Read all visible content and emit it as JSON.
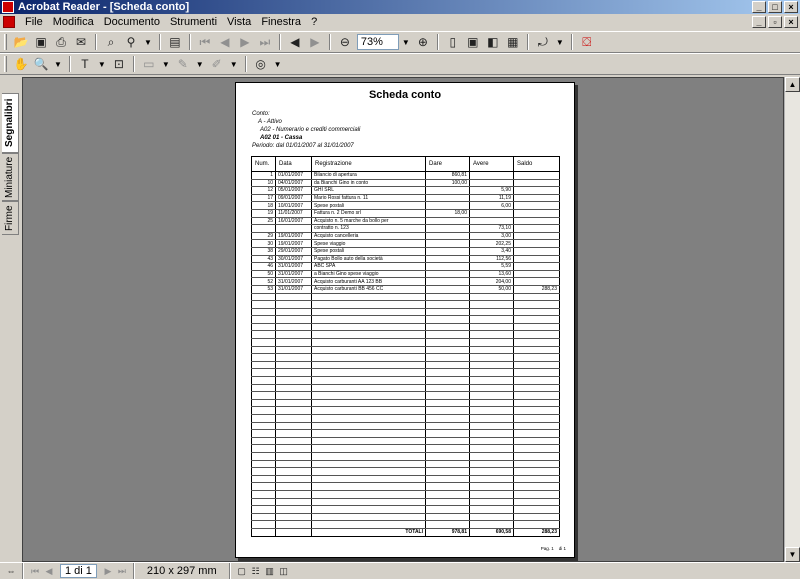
{
  "window": {
    "title": "Acrobat Reader - [Scheda conto]"
  },
  "menu": [
    "File",
    "Modifica",
    "Documento",
    "Strumenti",
    "Vista",
    "Finestra",
    "?"
  ],
  "toolbar": {
    "zoom": "73%"
  },
  "sidebar": {
    "tabs": [
      "Segnalibri",
      "Miniature",
      "Firme"
    ]
  },
  "document": {
    "title": "Scheda conto",
    "conto_label": "Conto:",
    "conto_l1": "A - Attivo",
    "conto_l2": "A02 - Numerario e crediti commerciali",
    "conto_l3": "A02 01 - Cassa",
    "periodo": "Periodo: dal 01/01/2007 al 31/01/2007",
    "columns": [
      "Num.",
      "Data",
      "Registrazione",
      "Dare",
      "Avere",
      "Saldo"
    ],
    "rows": [
      [
        "1",
        "01/01/2007",
        "Bilancio di apertura",
        "860,81",
        "",
        ""
      ],
      [
        "10",
        "04/01/2007",
        "da Bianchi Gino in conto",
        "100,00",
        "",
        ""
      ],
      [
        "12",
        "05/01/2007",
        "GHI SRL",
        "",
        "5,90",
        ""
      ],
      [
        "17",
        "09/01/2007",
        "Mario Rossi fattura n. 11",
        "",
        "11,19",
        ""
      ],
      [
        "18",
        "10/01/2007",
        "Spese postali",
        "",
        "6,00",
        ""
      ],
      [
        "19",
        "11/01/2007",
        "Fattura n. 2 Demo srl",
        "18,00",
        "",
        ""
      ],
      [
        "25",
        "16/01/2007",
        "Acquisto n. 5 marche da bollo per",
        "",
        "",
        ""
      ],
      [
        "",
        "",
        "contratto n. 123",
        "",
        "73,10",
        ""
      ],
      [
        "29",
        "19/01/2007",
        "Acquisto cancelleria",
        "",
        "3,00",
        ""
      ],
      [
        "30",
        "19/01/2007",
        "Spese viaggio",
        "",
        "202,25",
        ""
      ],
      [
        "38",
        "29/01/2007",
        "Spese postali",
        "",
        "3,40",
        ""
      ],
      [
        "43",
        "30/01/2007",
        "Pagato Bollo auto della società",
        "",
        "112,56",
        ""
      ],
      [
        "46",
        "31/01/2007",
        "ABC SPA",
        "",
        "5,59",
        ""
      ],
      [
        "50",
        "31/01/2007",
        "a Bianchi Gino spese viaggio",
        "",
        "13,60",
        ""
      ],
      [
        "52",
        "31/01/2007",
        "Acquisto carburanti AA 123 BB",
        "",
        "204,00",
        ""
      ],
      [
        "53",
        "31/01/2007",
        "Acquisto carburanti BB 456 CC",
        "",
        "50,00",
        "288,23"
      ]
    ],
    "blank_rows": 31,
    "totals": {
      "label": "TOTALI",
      "dare": "978,81",
      "avere": "690,58",
      "saldo": "288,23"
    },
    "footer_page": "Pag. 1",
    "footer_of": "di 1"
  },
  "status": {
    "page": "1 di 1",
    "size": "210 x 297 mm"
  }
}
